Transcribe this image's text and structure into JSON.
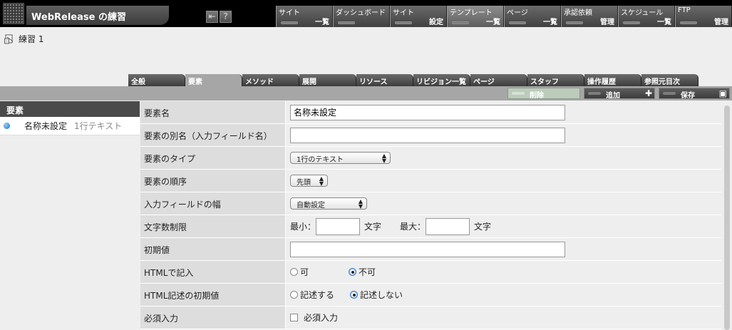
{
  "app": {
    "title": "WebRelease の練習"
  },
  "header_icons": [
    {
      "name": "exit-icon",
      "glyph": "⇤"
    },
    {
      "name": "help-icon",
      "glyph": "?"
    }
  ],
  "nav": [
    {
      "top": "サイト",
      "bottom": "一覧"
    },
    {
      "top": "ダッシュボード",
      "bottom": ""
    },
    {
      "top": "サイト",
      "bottom": "設定"
    },
    {
      "top": "テンプレート",
      "bottom": "一覧"
    },
    {
      "top": "ページ",
      "bottom": "一覧"
    },
    {
      "top": "承認依頼",
      "bottom": "管理"
    },
    {
      "top": "スケジュール",
      "bottom": "一覧"
    },
    {
      "top": "FTP",
      "bottom": "管理"
    }
  ],
  "breadcrumb": {
    "label": "練習 1"
  },
  "tabs": [
    "全般",
    "要素",
    "メソッド",
    "展開",
    "リソース",
    "リビジョン一覧",
    "ページ",
    "スタッフ",
    "操作履歴",
    "参照元目次"
  ],
  "toolbar": {
    "delete_label": "削除",
    "add_label": "追加",
    "save_label": "保存"
  },
  "element_list": {
    "heading": "要素",
    "items": [
      {
        "name": "名称未設定",
        "type": "1行テキスト"
      }
    ]
  },
  "form": {
    "name_label": "要素名",
    "name_value": "名称未設定",
    "alias_label": "要素の別名（入力フィールド名）",
    "alias_value": "",
    "type_label": "要素のタイプ",
    "type_value": "1行のテキスト",
    "order_label": "要素の順序",
    "order_value": "先頭",
    "width_label": "入力フィールドの幅",
    "width_value": "自動設定",
    "limit_label": "文字数制限",
    "min_label": "最小：",
    "max_label": "最大：",
    "unit_label": "文字",
    "initial_label": "初期値",
    "initial_value": "",
    "html_label": "HTMLで記入",
    "html_yes": "可",
    "html_no": "不可",
    "html_default_label": "HTML記述の初期値",
    "html_default_yes": "記述する",
    "html_default_no": "記述しない",
    "required_label": "必須入力",
    "required_check_label": "必須入力"
  }
}
